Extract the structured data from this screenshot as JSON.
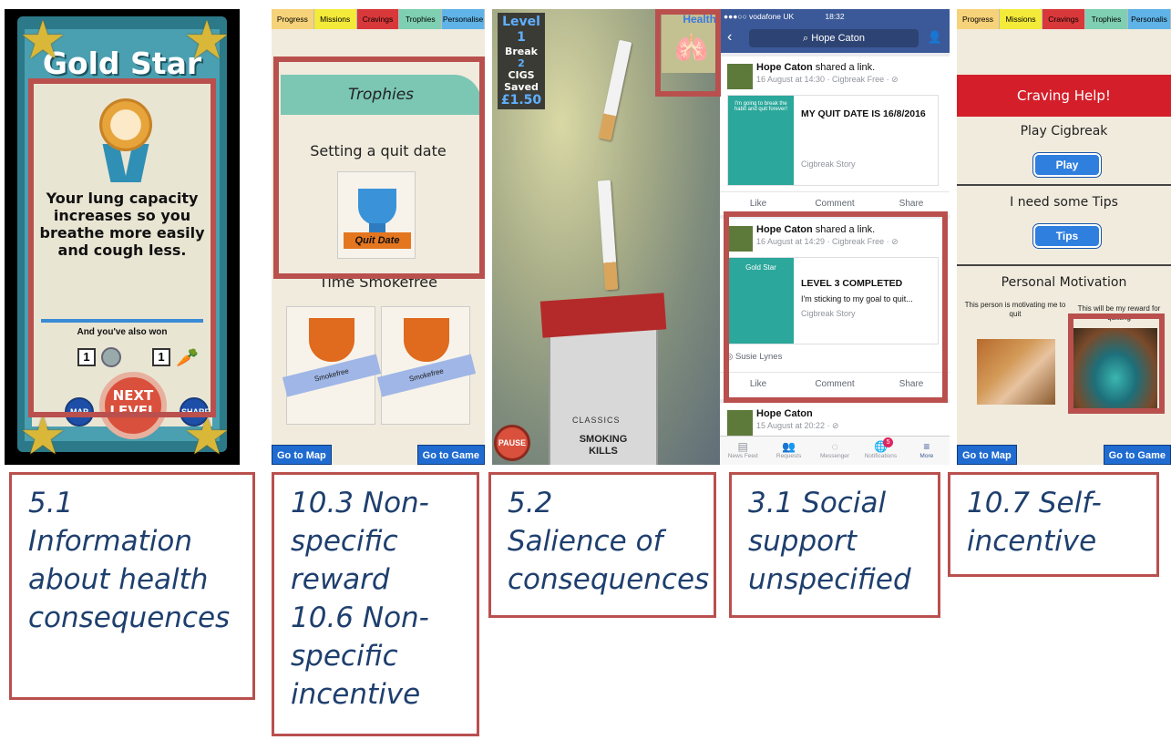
{
  "screen1": {
    "title": "Gold Star",
    "message": "Your lung capacity increases so you breathe more easily and cough less.",
    "also_won": "And you've also won",
    "counters": [
      "1",
      "1"
    ],
    "map_label": "MAP",
    "next_label": "NEXT LEVEL",
    "share_label": "SHARE"
  },
  "screen2": {
    "tabs": [
      "Progress",
      "Missions",
      "Cravings",
      "Trophies",
      "Personalise"
    ],
    "banner": "Trophies",
    "label1": "Setting a quit date",
    "quit_badge": "Quit Date",
    "label2": "Time Smokefree",
    "band_text": "Smokefree",
    "go_map": "Go to Map",
    "go_game": "Go to Game"
  },
  "screen3": {
    "level": "Level 1",
    "break_label": "Break",
    "break_count": "2",
    "cigs_label": "CIGS",
    "saved_label": "Saved",
    "saved_value": "£1.50",
    "health": "Health",
    "pack_brand": "CLASSICS",
    "pack_warning": "SMOKING KILLS",
    "pause": "PAUSE"
  },
  "screen4": {
    "carrier": "●●●○○ vodafone UK",
    "time": "18:32",
    "search": "Hope Caton",
    "post1": {
      "name": "Hope Caton",
      "action": "shared a link.",
      "meta": "16 August at 14:30 · Cigbreak Free · ⊘",
      "thumb": "I'm going to break the habit and quit forever!",
      "title": "MY QUIT DATE IS 16/8/2016",
      "source": "Cigbreak Story"
    },
    "post2": {
      "name": "Hope Caton",
      "action": "shared a link.",
      "meta": "16 August at 14:29 · Cigbreak Free · ⊘",
      "thumb": "Gold Star",
      "title": "LEVEL 3 COMPLETED",
      "desc": "I'm sticking to my goal to quit...",
      "source": "Cigbreak Story",
      "liker": "Susie Lynes"
    },
    "post3": {
      "name": "Hope Caton",
      "meta": "15 August at 20:22 · ⊘"
    },
    "actions": [
      "Like",
      "Comment",
      "Share"
    ],
    "tabbar": [
      "News Feed",
      "Requests",
      "Messenger",
      "Notifications",
      "More"
    ],
    "notif_count": "5"
  },
  "screen5": {
    "tabs": [
      "Progress",
      "Missions",
      "Cravings",
      "Trophies",
      "Personalis"
    ],
    "header": "Craving Help!",
    "play_heading": "Play Cigbreak",
    "play_button": "Play",
    "tips_heading": "I need some Tips",
    "tips_button": "Tips",
    "motivation": "Personal Motivation",
    "person_caption": "This person is motivating me to quit",
    "reward_caption": "This will be my reward for quitting",
    "go_map": "Go to Map",
    "go_game": "Go to Game"
  },
  "captions": {
    "c1": [
      "5.1",
      "Information",
      "about health",
      "consequences"
    ],
    "c2": [
      "10.3 Non-",
      "specific",
      "reward",
      "10.6 Non-",
      "specific",
      "incentive"
    ],
    "c3": [
      "5.2",
      "Salience of",
      "consequences"
    ],
    "c4": [
      "3.1 Social",
      "support",
      "unspecified"
    ],
    "c5": [
      "10.7 Self-",
      "incentive"
    ]
  }
}
